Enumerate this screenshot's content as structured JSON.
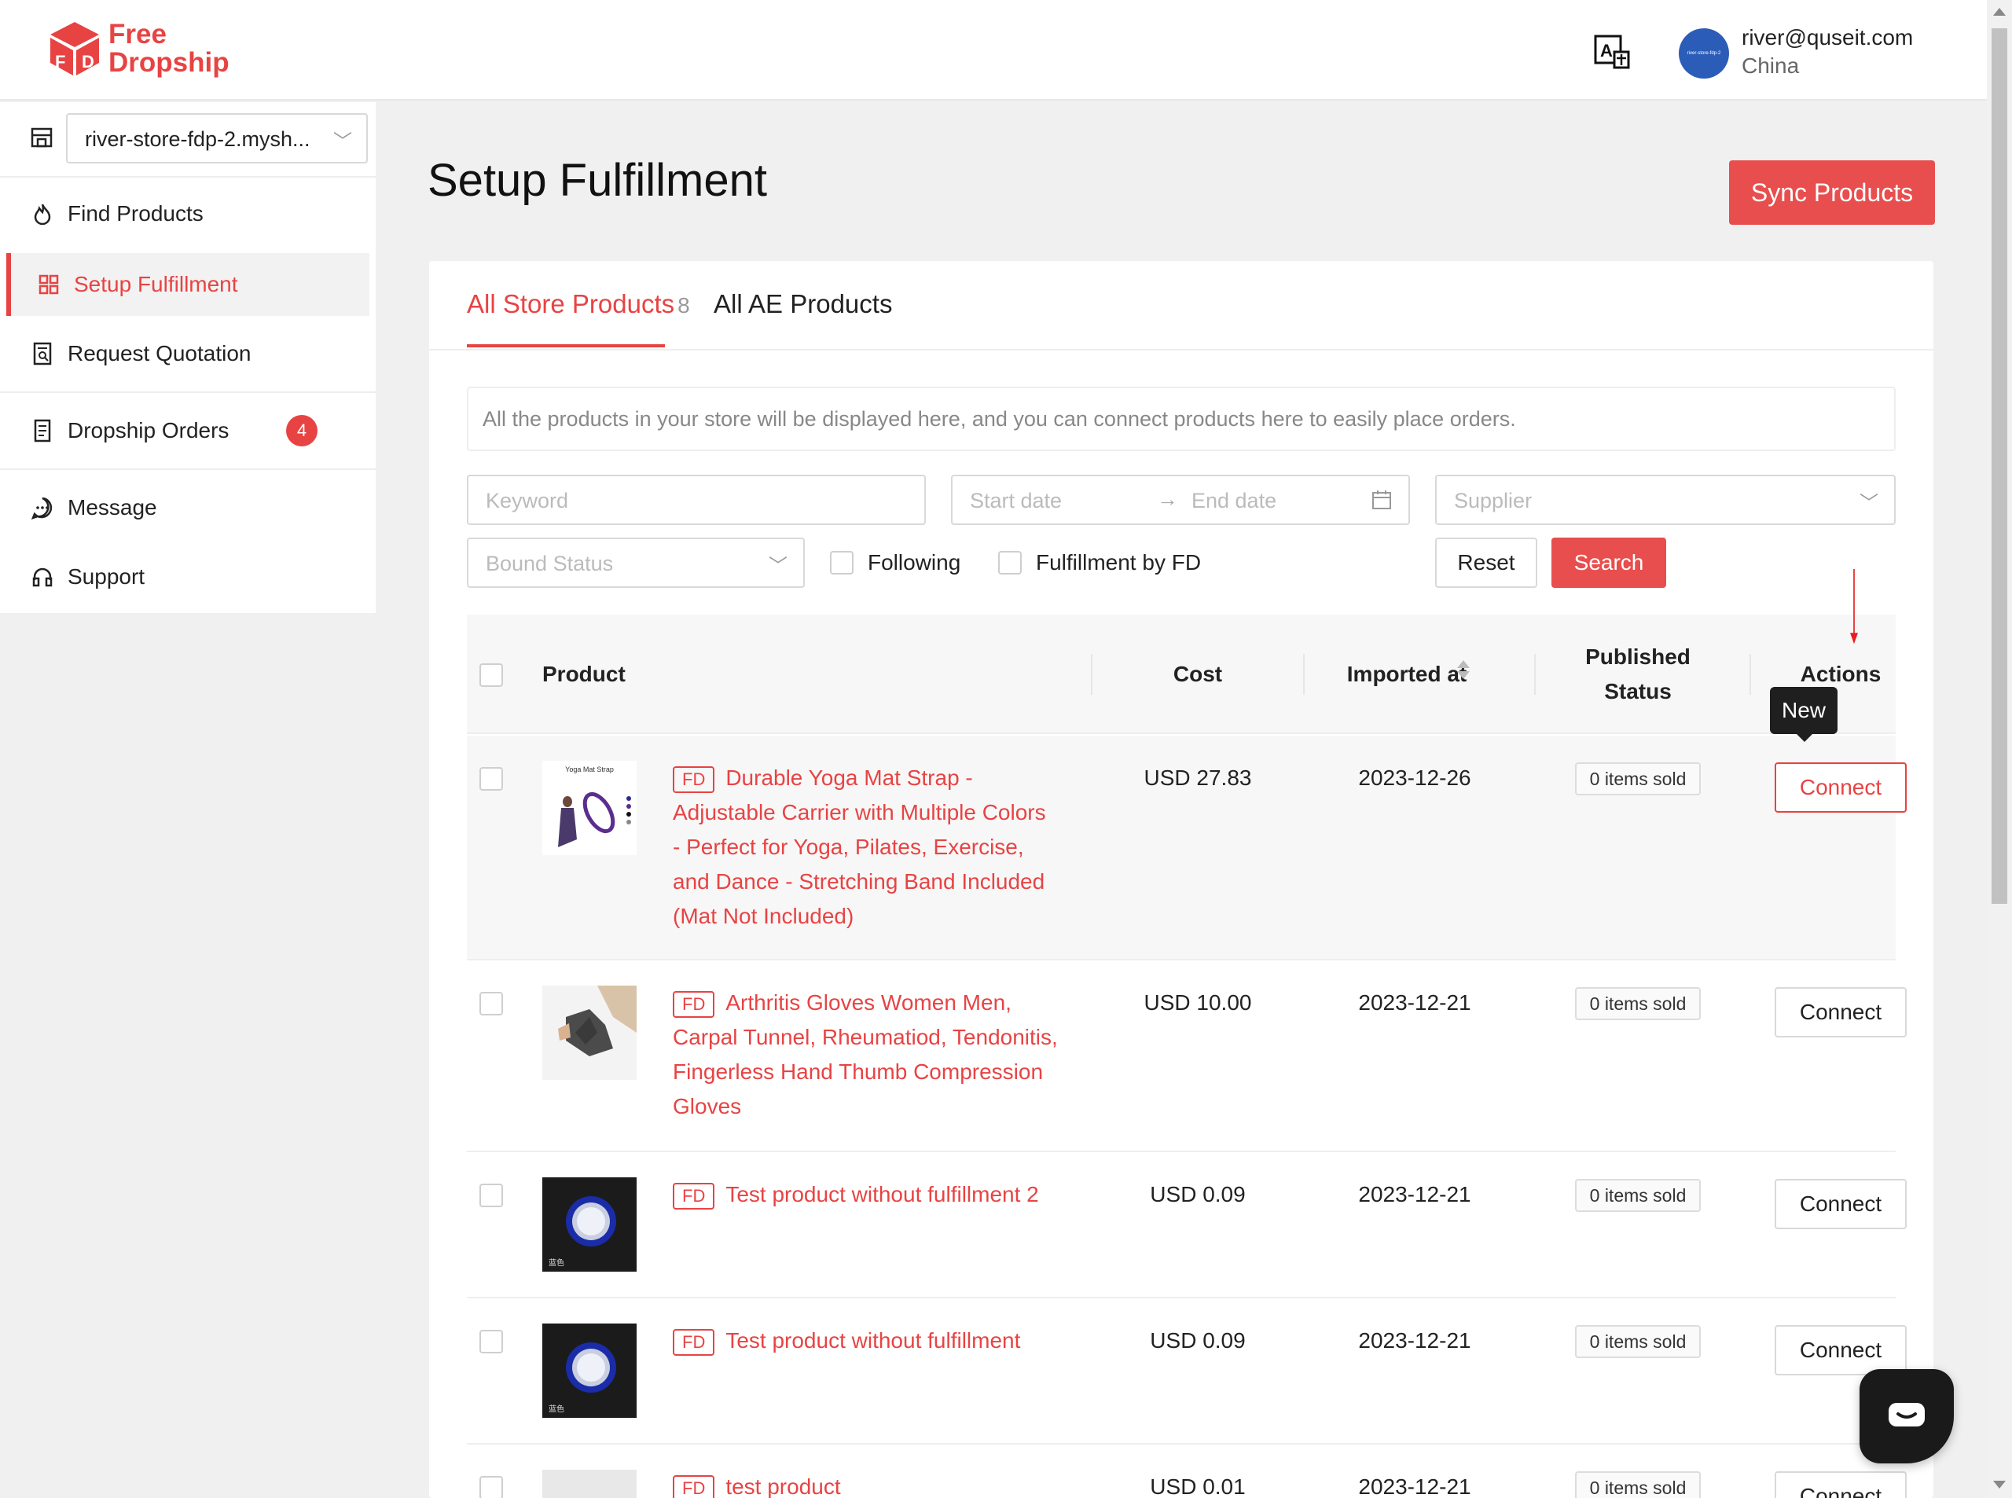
{
  "app": {
    "logo_line1": "Free",
    "logo_line2": "Dropship",
    "brand_color": "#e84343"
  },
  "header": {
    "avatar_text": "river-store-fdp-2",
    "user_email": "river@quseit.com",
    "user_country": "China"
  },
  "sidebar": {
    "store_select": "river-store-fdp-2.mysh...",
    "items": [
      {
        "label": "Find Products",
        "icon": "fire-icon"
      },
      {
        "label": "Setup Fulfillment",
        "icon": "grid-icon",
        "active": true
      },
      {
        "label": "Request Quotation",
        "icon": "quote-icon"
      },
      {
        "label": "Dropship Orders",
        "icon": "orders-icon",
        "badge": "4"
      },
      {
        "label": "Message",
        "icon": "message-icon"
      },
      {
        "label": "Support",
        "icon": "headset-icon"
      }
    ]
  },
  "main": {
    "title": "Setup Fulfillment",
    "sync_label": "Sync Products",
    "tabs": [
      {
        "label": "All Store Products",
        "count": "8"
      },
      {
        "label": "All AE Products"
      }
    ],
    "info": "All the products in your store will be displayed here, and you can connect products here to easily place orders.",
    "filters": {
      "keyword_placeholder": "Keyword",
      "start_placeholder": "Start date",
      "end_placeholder": "End date",
      "supplier_placeholder": "Supplier",
      "bound_placeholder": "Bound Status",
      "following_label": "Following",
      "fulfillment_label": "Fulfillment by FD",
      "reset_label": "Reset",
      "search_label": "Search"
    },
    "table": {
      "headers": {
        "product": "Product",
        "cost": "Cost",
        "imported": "Imported at",
        "published_1": "Published",
        "published_2": "Status",
        "actions": "Actions"
      },
      "tooltip": "New",
      "rows": [
        {
          "tag": "FD",
          "name": "Durable Yoga Mat Strap - Adjustable Carrier with Multiple Colors - Perfect for Yoga, Pilates, Exercise, and Dance - Stretching Band Included (Mat Not Included)",
          "cost": "USD 27.83",
          "imported": "2023-12-26",
          "sold": "0 items sold",
          "action": "Connect",
          "thumb_caption": "Yoga Mat Strap"
        },
        {
          "tag": "FD",
          "name": "Arthritis Gloves Women Men, Carpal Tunnel, Rheumatiod, Tendonitis, Fingerless Hand Thumb Compression Gloves",
          "cost": "USD 10.00",
          "imported": "2023-12-21",
          "sold": "0 items sold",
          "action": "Connect"
        },
        {
          "tag": "FD",
          "name": "Test product without fulfillment 2",
          "cost": "USD 0.09",
          "imported": "2023-12-21",
          "sold": "0 items sold",
          "action": "Connect",
          "thumb_caption": "蓝色"
        },
        {
          "tag": "FD",
          "name": "Test product without fulfillment",
          "cost": "USD 0.09",
          "imported": "2023-12-21",
          "sold": "0 items sold",
          "action": "Connect",
          "thumb_caption": "蓝色"
        },
        {
          "tag": "FD",
          "name": "test product",
          "cost": "USD 0.01",
          "imported": "2023-12-21",
          "sold": "0 items sold",
          "action": "Connect"
        }
      ]
    }
  }
}
